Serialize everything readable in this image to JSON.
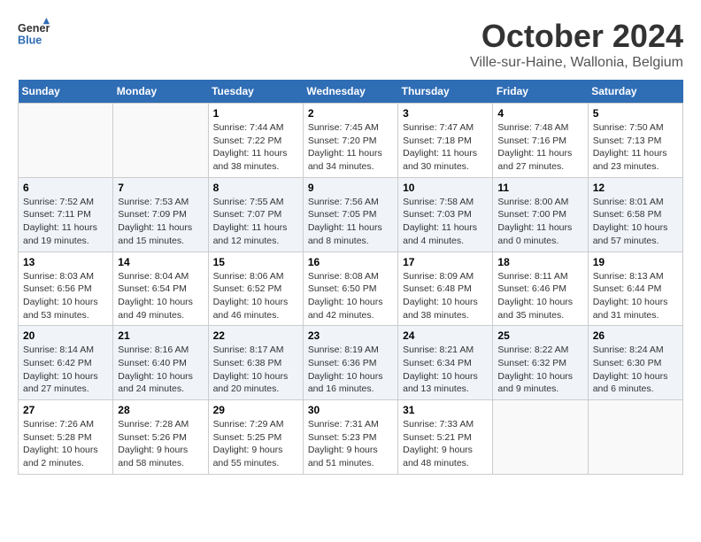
{
  "header": {
    "logo_line1": "General",
    "logo_line2": "Blue",
    "month_title": "October 2024",
    "location": "Ville-sur-Haine, Wallonia, Belgium"
  },
  "calendar": {
    "days_of_week": [
      "Sunday",
      "Monday",
      "Tuesday",
      "Wednesday",
      "Thursday",
      "Friday",
      "Saturday"
    ],
    "weeks": [
      [
        {
          "day": "",
          "info": ""
        },
        {
          "day": "",
          "info": ""
        },
        {
          "day": "1",
          "info": "Sunrise: 7:44 AM\nSunset: 7:22 PM\nDaylight: 11 hours and 38 minutes."
        },
        {
          "day": "2",
          "info": "Sunrise: 7:45 AM\nSunset: 7:20 PM\nDaylight: 11 hours and 34 minutes."
        },
        {
          "day": "3",
          "info": "Sunrise: 7:47 AM\nSunset: 7:18 PM\nDaylight: 11 hours and 30 minutes."
        },
        {
          "day": "4",
          "info": "Sunrise: 7:48 AM\nSunset: 7:16 PM\nDaylight: 11 hours and 27 minutes."
        },
        {
          "day": "5",
          "info": "Sunrise: 7:50 AM\nSunset: 7:13 PM\nDaylight: 11 hours and 23 minutes."
        }
      ],
      [
        {
          "day": "6",
          "info": "Sunrise: 7:52 AM\nSunset: 7:11 PM\nDaylight: 11 hours and 19 minutes."
        },
        {
          "day": "7",
          "info": "Sunrise: 7:53 AM\nSunset: 7:09 PM\nDaylight: 11 hours and 15 minutes."
        },
        {
          "day": "8",
          "info": "Sunrise: 7:55 AM\nSunset: 7:07 PM\nDaylight: 11 hours and 12 minutes."
        },
        {
          "day": "9",
          "info": "Sunrise: 7:56 AM\nSunset: 7:05 PM\nDaylight: 11 hours and 8 minutes."
        },
        {
          "day": "10",
          "info": "Sunrise: 7:58 AM\nSunset: 7:03 PM\nDaylight: 11 hours and 4 minutes."
        },
        {
          "day": "11",
          "info": "Sunrise: 8:00 AM\nSunset: 7:00 PM\nDaylight: 11 hours and 0 minutes."
        },
        {
          "day": "12",
          "info": "Sunrise: 8:01 AM\nSunset: 6:58 PM\nDaylight: 10 hours and 57 minutes."
        }
      ],
      [
        {
          "day": "13",
          "info": "Sunrise: 8:03 AM\nSunset: 6:56 PM\nDaylight: 10 hours and 53 minutes."
        },
        {
          "day": "14",
          "info": "Sunrise: 8:04 AM\nSunset: 6:54 PM\nDaylight: 10 hours and 49 minutes."
        },
        {
          "day": "15",
          "info": "Sunrise: 8:06 AM\nSunset: 6:52 PM\nDaylight: 10 hours and 46 minutes."
        },
        {
          "day": "16",
          "info": "Sunrise: 8:08 AM\nSunset: 6:50 PM\nDaylight: 10 hours and 42 minutes."
        },
        {
          "day": "17",
          "info": "Sunrise: 8:09 AM\nSunset: 6:48 PM\nDaylight: 10 hours and 38 minutes."
        },
        {
          "day": "18",
          "info": "Sunrise: 8:11 AM\nSunset: 6:46 PM\nDaylight: 10 hours and 35 minutes."
        },
        {
          "day": "19",
          "info": "Sunrise: 8:13 AM\nSunset: 6:44 PM\nDaylight: 10 hours and 31 minutes."
        }
      ],
      [
        {
          "day": "20",
          "info": "Sunrise: 8:14 AM\nSunset: 6:42 PM\nDaylight: 10 hours and 27 minutes."
        },
        {
          "day": "21",
          "info": "Sunrise: 8:16 AM\nSunset: 6:40 PM\nDaylight: 10 hours and 24 minutes."
        },
        {
          "day": "22",
          "info": "Sunrise: 8:17 AM\nSunset: 6:38 PM\nDaylight: 10 hours and 20 minutes."
        },
        {
          "day": "23",
          "info": "Sunrise: 8:19 AM\nSunset: 6:36 PM\nDaylight: 10 hours and 16 minutes."
        },
        {
          "day": "24",
          "info": "Sunrise: 8:21 AM\nSunset: 6:34 PM\nDaylight: 10 hours and 13 minutes."
        },
        {
          "day": "25",
          "info": "Sunrise: 8:22 AM\nSunset: 6:32 PM\nDaylight: 10 hours and 9 minutes."
        },
        {
          "day": "26",
          "info": "Sunrise: 8:24 AM\nSunset: 6:30 PM\nDaylight: 10 hours and 6 minutes."
        }
      ],
      [
        {
          "day": "27",
          "info": "Sunrise: 7:26 AM\nSunset: 5:28 PM\nDaylight: 10 hours and 2 minutes."
        },
        {
          "day": "28",
          "info": "Sunrise: 7:28 AM\nSunset: 5:26 PM\nDaylight: 9 hours and 58 minutes."
        },
        {
          "day": "29",
          "info": "Sunrise: 7:29 AM\nSunset: 5:25 PM\nDaylight: 9 hours and 55 minutes."
        },
        {
          "day": "30",
          "info": "Sunrise: 7:31 AM\nSunset: 5:23 PM\nDaylight: 9 hours and 51 minutes."
        },
        {
          "day": "31",
          "info": "Sunrise: 7:33 AM\nSunset: 5:21 PM\nDaylight: 9 hours and 48 minutes."
        },
        {
          "day": "",
          "info": ""
        },
        {
          "day": "",
          "info": ""
        }
      ]
    ]
  }
}
